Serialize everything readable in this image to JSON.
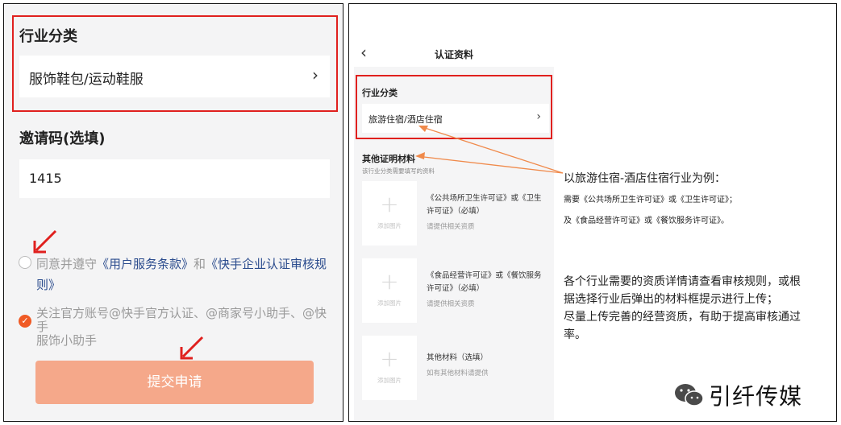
{
  "left": {
    "industry_title": "行业分类",
    "industry_value": "服饰鞋包/运动鞋服",
    "invite_title": "邀请码(选填)",
    "invite_value": "1415",
    "agree_prefix": "同意并遵守",
    "agree_link1": "《用户服务条款》",
    "agree_and": "和",
    "agree_link2_a": "《快手企业认证审核规",
    "agree_link2_b": "则》",
    "follow_line1": "关注官方账号@快手官方认证、@商家号小助手、@快手",
    "follow_line2": "服饰小助手",
    "submit_label": "提交申请"
  },
  "right": {
    "nav_title": "认证资料",
    "industry_title": "行业分类",
    "industry_value": "旅游住宿/酒店住宿",
    "other_title": "其他证明材料",
    "other_desc": "该行业分类需要填写的资料",
    "add_image_label": "添加图片",
    "docs": [
      {
        "line1": "《公共场所卫生许可证》或《卫生",
        "line2": "许可证》（必填）",
        "sub": "请提供相关资质"
      },
      {
        "line1": "《食品经营许可证》或《餐饮服务",
        "line2": "许可证》（必填）",
        "sub": "请提供相关资质"
      },
      {
        "line1": "其他材料（选填）",
        "line2": "",
        "sub": "如有其他材料请提供"
      }
    ],
    "note1_title": "以旅游住宿-酒店住宿行业为例：",
    "note1_line1": "需要《公共场所卫生许可证》或《卫生许可证》；",
    "note1_line2": "及《食品经营许可证》或《餐饮服务许可证》。",
    "note2_line1": "各个行业需要的资质详情请查看审核规则，或根",
    "note2_line2": "据选择行业后弹出的材料框提示进行上传；",
    "note2_line3": "尽量上传完善的经营资质，有助于提高审核通过",
    "note2_line4": "率。",
    "brand": "引纤传媒"
  },
  "colors": {
    "red_box": "#e0201e",
    "accent_orange": "#f05a24",
    "submit_bg": "#f5a88a",
    "link_blue": "#2a4b8d",
    "arrow_orange": "#f08a4b"
  }
}
